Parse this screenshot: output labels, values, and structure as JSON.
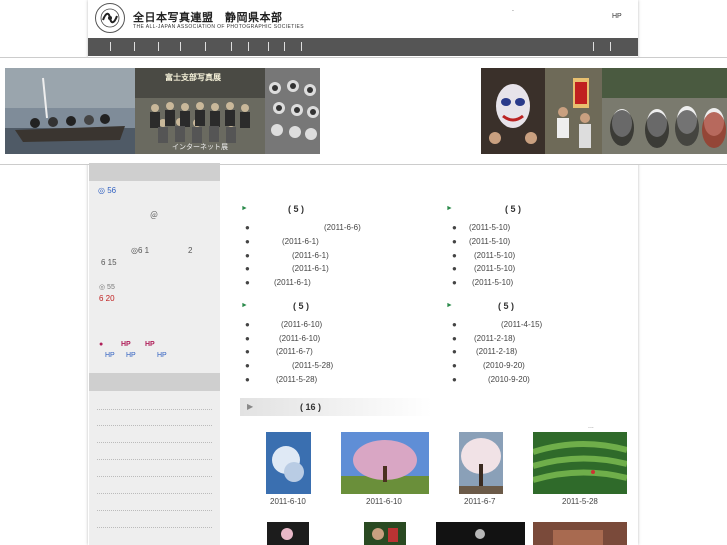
{
  "header": {
    "org_name": "全日本写真連盟　静岡県本部",
    "org_subtitle": "THE ALL-JAPAN ASSOCIATION OF PHOTOGRAPHIC SOCIETIES",
    "top_dot": ".",
    "hp_link": "HP"
  },
  "nav": {
    "separators": 11
  },
  "banner": {
    "group_caption": "富士支部写真展",
    "group_caption2": "インターネット展"
  },
  "sidebar": {
    "item1": "◎ 56",
    "item2": "＠",
    "item3": "◎6 1",
    "item3b": "2",
    "item4": "6 15",
    "item5": "◎ 55",
    "item6": "6 20",
    "links_row1": [
      "●",
      "HP",
      "HP"
    ],
    "links_row2": [
      "HP",
      "HP",
      "HP"
    ]
  },
  "columns": [
    {
      "title": "( 5 )",
      "items": [
        "(2011-6-6)",
        "(2011-6-1)",
        "(2011-6-1)",
        "(2011-6-1)",
        "(2011-6-1)"
      ]
    },
    {
      "title": "( 5 )",
      "items": [
        "(2011-5-10)",
        "(2011-5-10)",
        "(2011-5-10)",
        "(2011-5-10)",
        "(2011-5-10)"
      ]
    },
    {
      "title": "( 5 )",
      "items": [
        "(2011-6-10)",
        "(2011-6-10)",
        "(2011-6-7)",
        "(2011-5-28)",
        "(2011-5-28)"
      ]
    },
    {
      "title": "( 5 )",
      "items": [
        "(2011-4-15)",
        "(2011-2-18)",
        "(2011-2-18)",
        "(2010-9-20)",
        "(2010-9-20)"
      ]
    }
  ],
  "photos": {
    "title": "( 16 )",
    "more": "...",
    "thumbs": [
      {
        "date": "2011-6-10"
      },
      {
        "date": "2011-6-10"
      },
      {
        "date": "2011-6-7"
      },
      {
        "date": "2011-5-28"
      }
    ]
  }
}
